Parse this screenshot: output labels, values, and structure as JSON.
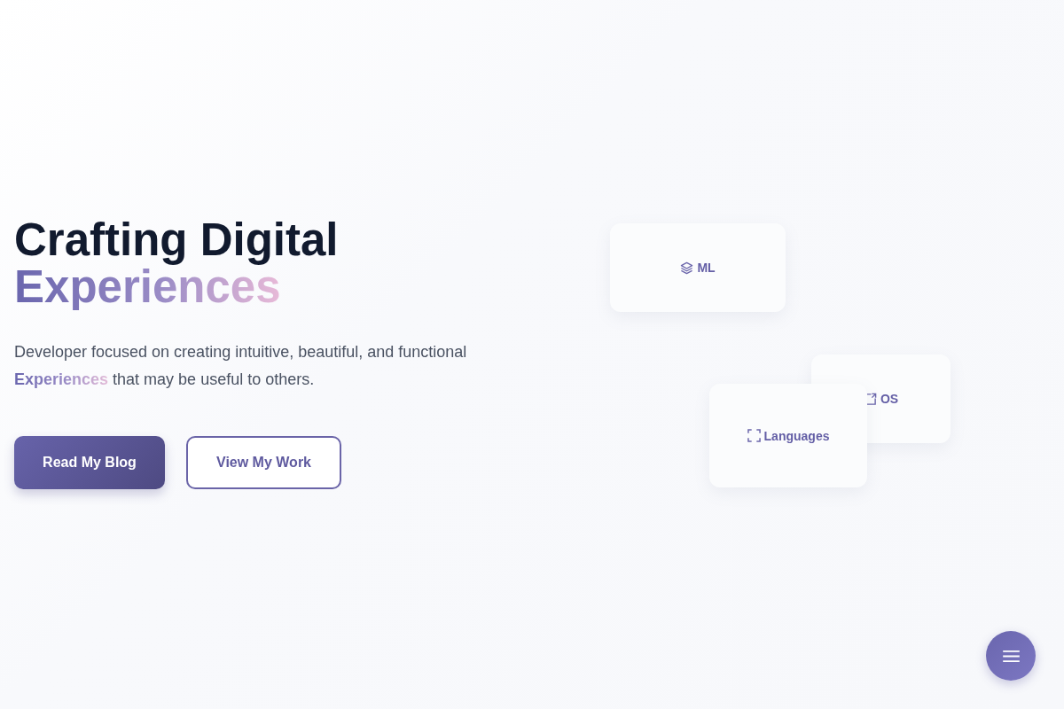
{
  "hero": {
    "title": "Crafting Digital",
    "title_highlight": "Experiences",
    "description": "Developer focused on creating intuitive, beautiful, and functional **Experiences** that may be useful to others.",
    "buttons": [
      {
        "label": "Read My Blog",
        "kind": "primary"
      },
      {
        "label": "View My Work",
        "kind": "outline"
      }
    ]
  },
  "floating_cards": [
    {
      "label": "ML"
    },
    {
      "label": "OS"
    },
    {
      "label": "Languages"
    }
  ]
}
